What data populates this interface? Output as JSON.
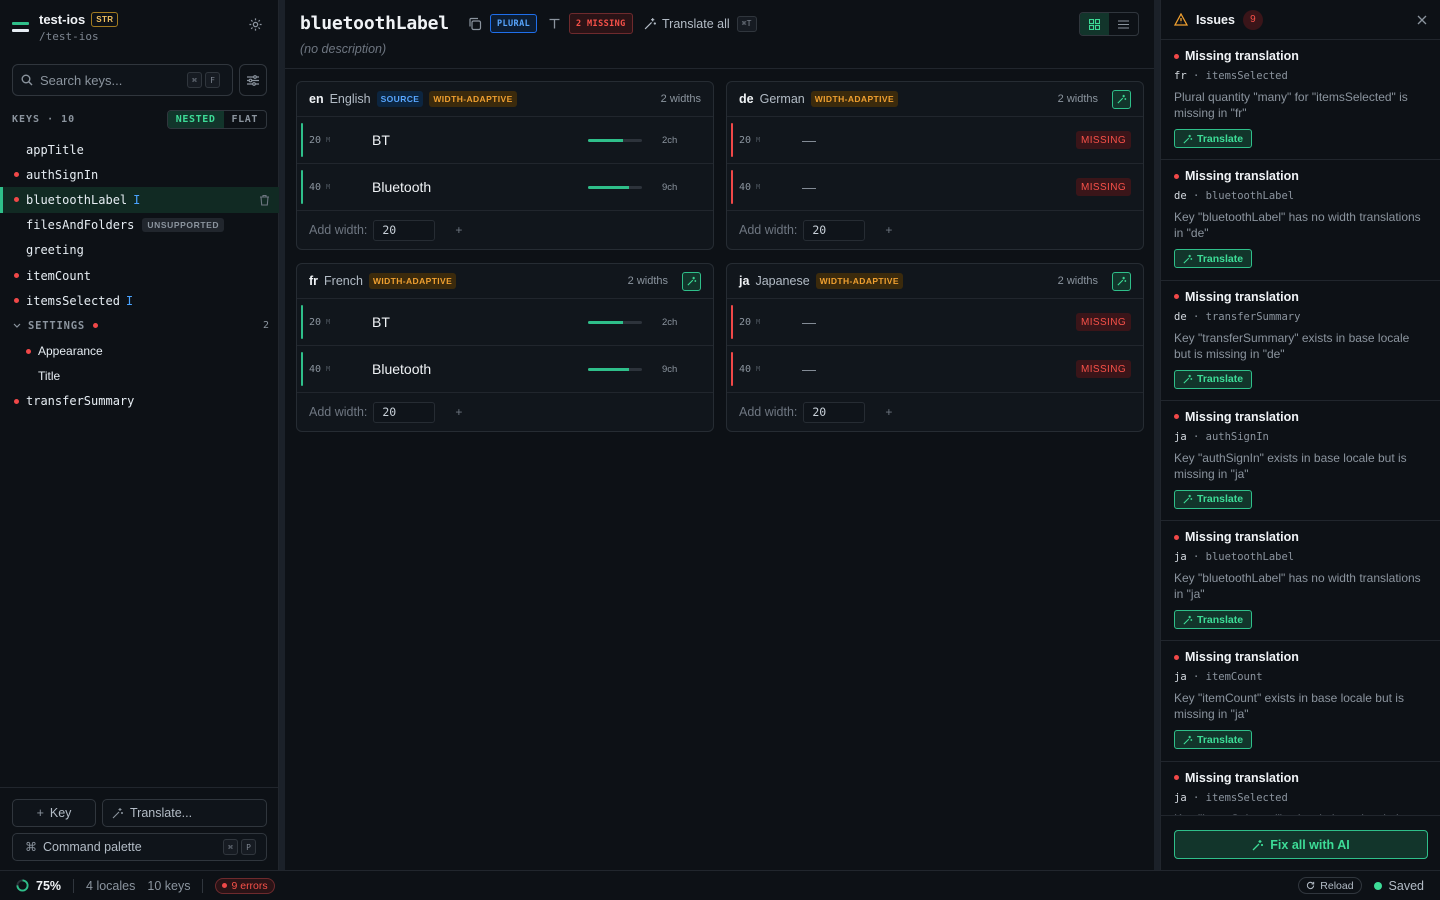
{
  "project": {
    "name": "test-ios",
    "badge": "STR",
    "path": "/test-ios"
  },
  "search": {
    "placeholder": "Search keys...",
    "shortcut": [
      "⌘",
      "F"
    ]
  },
  "keys_header": {
    "label": "KEYS · 10",
    "modes": [
      "NESTED",
      "FLAT"
    ],
    "active_mode": "NESTED"
  },
  "tree": [
    {
      "label": "appTitle",
      "error": false
    },
    {
      "label": "authSignIn",
      "error": true
    },
    {
      "label": "bluetoothLabel",
      "error": true,
      "selected": true,
      "cursor": "I"
    },
    {
      "label": "filesAndFolders",
      "error": false,
      "tag": "UNSUPPORTED"
    },
    {
      "label": "greeting",
      "error": false
    },
    {
      "label": "itemCount",
      "error": true
    },
    {
      "label": "itemsSelected",
      "error": true,
      "cursor": "I"
    },
    {
      "label": "SETTINGS",
      "group": true,
      "error": true,
      "count": "2"
    },
    {
      "label": "Appearance",
      "child": true,
      "error": true
    },
    {
      "label": "Title",
      "child": true,
      "error": false
    },
    {
      "label": "transferSummary",
      "error": true
    }
  ],
  "sidebar_actions": {
    "add_key": "Key",
    "translate": "Translate...",
    "palette": "Command palette",
    "palette_kbd": [
      "⌘",
      "P"
    ]
  },
  "status_bar": {
    "progress": "75%",
    "progress_value": 0.75,
    "locales": "4 locales",
    "keys": "10 keys",
    "errors": "9 errors",
    "reload": "Reload",
    "saved": "Saved"
  },
  "key_header": {
    "title": "bluetoothLabel",
    "plural_badge": "PLURAL",
    "missing_badge": "2 MISSING",
    "translate_all": "Translate all",
    "translate_all_kbd": "⌘T",
    "description": "(no description)"
  },
  "locales": [
    {
      "code": "en",
      "name": "English",
      "source": "SOURCE",
      "mode": "WIDTH-ADAPTIVE",
      "widths_label": "2 widths",
      "ai": false,
      "rows": [
        {
          "width": "20",
          "unit": "M",
          "text": "BT",
          "chars": "2ch",
          "fill": 0.65
        },
        {
          "width": "40",
          "unit": "M",
          "text": "Bluetooth",
          "chars": "9ch",
          "fill": 0.75
        }
      ],
      "add_label": "Add width:",
      "add_value": "20"
    },
    {
      "code": "de",
      "name": "German",
      "mode": "WIDTH-ADAPTIVE",
      "widths_label": "2 widths",
      "ai": true,
      "rows": [
        {
          "width": "20",
          "unit": "M",
          "text": "—",
          "missing": "MISSING"
        },
        {
          "width": "40",
          "unit": "M",
          "text": "—",
          "missing": "MISSING"
        }
      ],
      "add_label": "Add width:",
      "add_value": "20"
    },
    {
      "code": "fr",
      "name": "French",
      "mode": "WIDTH-ADAPTIVE",
      "widths_label": "2 widths",
      "ai": true,
      "rows": [
        {
          "width": "20",
          "unit": "M",
          "text": "BT",
          "chars": "2ch",
          "fill": 0.65
        },
        {
          "width": "40",
          "unit": "M",
          "text": "Bluetooth",
          "chars": "9ch",
          "fill": 0.75
        }
      ],
      "add_label": "Add width:",
      "add_value": "20"
    },
    {
      "code": "ja",
      "name": "Japanese",
      "mode": "WIDTH-ADAPTIVE",
      "widths_label": "2 widths",
      "ai": true,
      "rows": [
        {
          "width": "20",
          "unit": "M",
          "text": "—",
          "missing": "MISSING"
        },
        {
          "width": "40",
          "unit": "M",
          "text": "—",
          "missing": "MISSING"
        }
      ],
      "add_label": "Add width:",
      "add_value": "20"
    }
  ],
  "issues": {
    "title": "Issues",
    "count": "9",
    "fix_all": "Fix all with AI",
    "translate_label": "Translate",
    "items": [
      {
        "title": "Missing translation",
        "locale": "fr",
        "key": "itemsSelected",
        "message": "Plural quantity \"many\" for \"itemsSelected\" is missing in \"fr\""
      },
      {
        "title": "Missing translation",
        "locale": "de",
        "key": "bluetoothLabel",
        "message": "Key \"bluetoothLabel\" has no width translations in \"de\""
      },
      {
        "title": "Missing translation",
        "locale": "de",
        "key": "transferSummary",
        "message": "Key \"transferSummary\" exists in base locale but is missing in \"de\""
      },
      {
        "title": "Missing translation",
        "locale": "ja",
        "key": "authSignIn",
        "message": "Key \"authSignIn\" exists in base locale but is missing in \"ja\""
      },
      {
        "title": "Missing translation",
        "locale": "ja",
        "key": "bluetoothLabel",
        "message": "Key \"bluetoothLabel\" has no width translations in \"ja\""
      },
      {
        "title": "Missing translation",
        "locale": "ja",
        "key": "itemCount",
        "message": "Key \"itemCount\" exists in base locale but is missing in \"ja\""
      },
      {
        "title": "Missing translation",
        "locale": "ja",
        "key": "itemsSelected",
        "message": "Key \"itemsSelected\" exists in base locale but is missing in \"ja\""
      }
    ]
  },
  "colors": {
    "accent": "#2fbf8a",
    "error": "#f04848",
    "warning": "#f0a030",
    "info": "#4aa3ff"
  }
}
